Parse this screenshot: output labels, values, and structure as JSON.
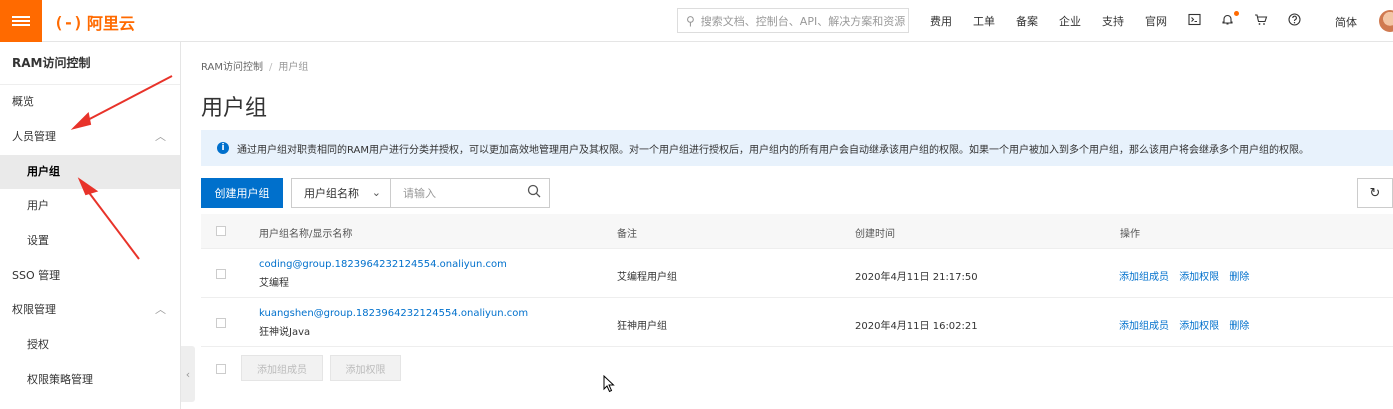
{
  "brand": {
    "logo_mark": "(-)",
    "logo_text": "阿里云",
    "accent": "#ff6a00"
  },
  "search": {
    "placeholder": "搜索文档、控制台、API、解决方案和资源"
  },
  "topnav": [
    "费用",
    "工单",
    "备案",
    "企业",
    "支持",
    "官网"
  ],
  "topicons": [
    "terminal-icon",
    "bell-icon",
    "cart-icon",
    "help-icon"
  ],
  "language": "简体",
  "sidebar": {
    "title": "RAM访问控制",
    "items": [
      {
        "label": "概览"
      },
      {
        "label": "人员管理",
        "chevron": "︿"
      },
      {
        "label": "用户组"
      },
      {
        "label": "用户"
      },
      {
        "label": "设置"
      },
      {
        "label": "SSO 管理"
      },
      {
        "label": "权限管理",
        "chevron": "︿"
      },
      {
        "label": "授权"
      },
      {
        "label": "权限策略管理"
      }
    ]
  },
  "breadcrumb": {
    "root": "RAM访问控制",
    "sep": "/",
    "current": "用户组"
  },
  "page_title": "用户组",
  "notice": "通过用户组对职责相同的RAM用户进行分类并授权，可以更加高效地管理用户及其权限。对一个用户组进行授权后，用户组内的所有用户会自动继承该用户组的权限。如果一个用户被加入到多个用户组，那么该用户将会继承多个用户组的权限。",
  "toolbar": {
    "create_label": "创建用户组",
    "filter_select": "用户组名称",
    "search_placeholder": "请输入"
  },
  "table": {
    "headers": [
      "用户组名称/显示名称",
      "备注",
      "创建时间",
      "操作"
    ],
    "rows": [
      {
        "name": "coding@group.1823964232124554.onaliyun.com",
        "display": "艾编程",
        "remark": "艾编程用户组",
        "created": "2020年4月11日 21:17:50",
        "ops": [
          "添加组成员",
          "添加权限",
          "删除"
        ]
      },
      {
        "name": "kuangshen@group.1823964232124554.onaliyun.com",
        "display": "狂神说Java",
        "remark": "狂神用户组",
        "created": "2020年4月11日 16:02:21",
        "ops": [
          "添加组成员",
          "添加权限",
          "删除"
        ]
      }
    ]
  },
  "bulk": {
    "add_member": "添加组成员",
    "add_permission": "添加权限"
  },
  "colors": {
    "primary": "#0070cc",
    "annotation": "#e8332a"
  }
}
